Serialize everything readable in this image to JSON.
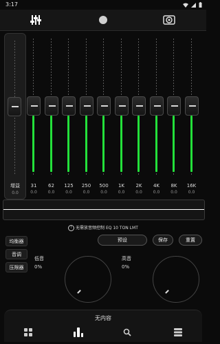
{
  "status": {
    "time": "3:17"
  },
  "topbar": {
    "tabs": [
      "equalizer-tab",
      "visualizer-tab",
      "speaker-tab"
    ]
  },
  "gain": {
    "label": "增益",
    "value": "0.0"
  },
  "bands": [
    {
      "freq": "31",
      "value": "0.0"
    },
    {
      "freq": "62",
      "value": "0.0"
    },
    {
      "freq": "125",
      "value": "0.0"
    },
    {
      "freq": "250",
      "value": "0.0"
    },
    {
      "freq": "500",
      "value": "0.0"
    },
    {
      "freq": "1K",
      "value": "0.0"
    },
    {
      "freq": "2K",
      "value": "0.0"
    },
    {
      "freq": "4K",
      "value": "0.0"
    },
    {
      "freq": "8K",
      "value": "0.0"
    },
    {
      "freq": "16K",
      "value": "0.0"
    }
  ],
  "notice": "无需放音频控制 EQ 10 TON LMT",
  "buttons": {
    "preset": "预设",
    "save": "保存",
    "reset": "重置"
  },
  "side": {
    "equalizer": "均衡器",
    "tone": "音调",
    "limiter": "压限器"
  },
  "bass": {
    "label": "低音",
    "value": "0%"
  },
  "treble": {
    "label": "高音",
    "value": "0%"
  },
  "player": {
    "status": "无内容"
  },
  "colors": {
    "accent": "#23e03a",
    "background": "#0b0b0b"
  }
}
